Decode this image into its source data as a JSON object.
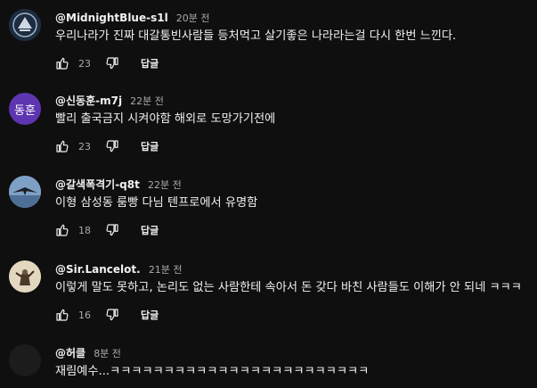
{
  "comments": [
    {
      "author": "@MidnightBlue-s1l",
      "time": "20분 전",
      "text": "우리나라가 진짜 대갈통빈사람들 등처먹고 살기좋은 나라라는걸 다시 한번 느낀다.",
      "likes": "23",
      "reply": "답글",
      "avatar_color": "#2a3a52"
    },
    {
      "author": "@신동훈-m7j",
      "time": "22분 전",
      "text": "빨리 출국금지 시켜야함 해외로 도망가기전에",
      "likes": "23",
      "reply": "답글",
      "avatar_initials": "동훈",
      "avatar_color": "#5e35b1"
    },
    {
      "author": "@갈색폭격기-q8t",
      "time": "22분 전",
      "text": "이형 삼성동 룸빵 다님 텐프로에서 유명함",
      "likes": "18",
      "reply": "답글",
      "avatar_color": "#6b8fb8"
    },
    {
      "author": "@Sir.Lancelot.",
      "time": "21분 전",
      "text": "이렇게 말도 못하고, 논리도 없는 사람한테 속아서 돈 갖다 바친 사람들도 이해가 안 되네 ㅋㅋㅋ",
      "likes": "16",
      "reply": "답글",
      "avatar_color": "#d8cbb0"
    },
    {
      "author": "@허클",
      "time": "8분 전",
      "text": "재림예수...ㅋㅋㅋㅋㅋㅋㅋㅋㅋㅋㅋㅋㅋㅋㅋㅋㅋㅋㅋㅋㅋㅋㅋㅋ",
      "avatar_color": "#1c1c1c"
    }
  ]
}
